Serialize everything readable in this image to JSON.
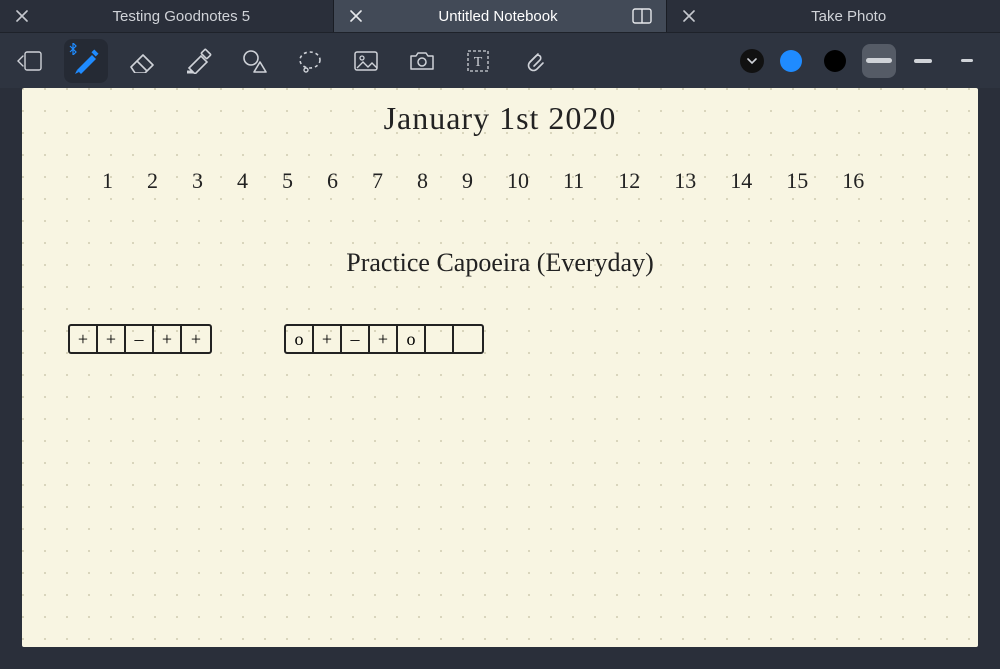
{
  "tabs": [
    {
      "label": "Testing Goodnotes 5",
      "active": false
    },
    {
      "label": "Untitled Notebook",
      "active": true
    },
    {
      "label": "Take Photo",
      "active": false
    }
  ],
  "tools": {
    "page_nav": "page-nav-icon",
    "pen": "pen-icon",
    "eraser": "eraser-icon",
    "highlighter": "highlighter-icon",
    "shape": "shape-icon",
    "lasso": "lasso-icon",
    "image": "image-icon",
    "camera": "camera-icon",
    "text": "text-icon",
    "link": "link-icon"
  },
  "style": {
    "dropdown": "chevron-down",
    "colors": [
      "#1f8bff",
      "#000000"
    ],
    "stroke_widths": [
      26,
      18,
      12
    ],
    "selected_stroke_index": 0
  },
  "note": {
    "title": "January 1st 2020",
    "numbers": [
      "1",
      "2",
      "3",
      "4",
      "5",
      "6",
      "7",
      "8",
      "9",
      "10",
      "11",
      "12",
      "13",
      "14",
      "15",
      "16"
    ],
    "subhead": "Practice Capoeira (Everyday)",
    "track1": [
      "+",
      "+",
      "–",
      "+",
      "+"
    ],
    "track2": [
      "o",
      "+",
      "–",
      "+",
      "o",
      "",
      ""
    ]
  }
}
